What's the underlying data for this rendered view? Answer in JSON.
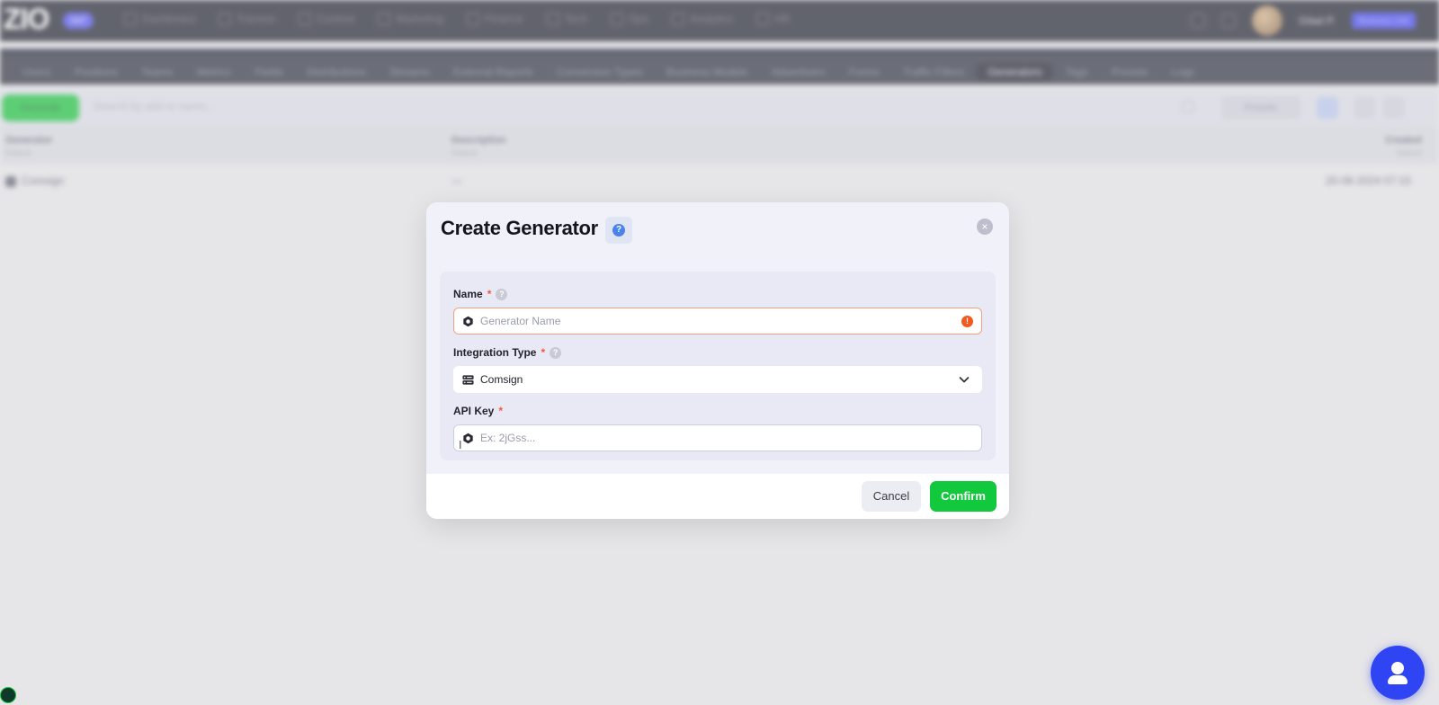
{
  "app": {
    "logo": {
      "text": "ZIO",
      "badge": "SNT"
    },
    "top_nav": [
      "Dashboard",
      "Traceon",
      "Content",
      "Marketing",
      "Finance",
      "Tech",
      "Ops",
      "Analytics",
      "HR"
    ],
    "user": {
      "name": "Gilad P.",
      "badge": "Business Unit"
    },
    "sub_nav": {
      "items": [
        "Users",
        "Positions",
        "Teams",
        "Metrics",
        "Fields",
        "Distributions",
        "Streams",
        "External Reports",
        "Conversion Types",
        "Business Models",
        "Advertisers",
        "Forms",
        "Traffic Filters",
        "Generators",
        "Tags",
        "Presets",
        "Logs"
      ],
      "active": "Generators"
    },
    "toolbar": {
      "new_button": "Generate",
      "search_placeholder": "Search by add or name...",
      "presets": "Presets"
    },
    "table": {
      "headers": [
        {
          "label": "Generator",
          "sub": "Default"
        },
        {
          "label": "Description",
          "sub": "Default"
        },
        {
          "label": "Created",
          "sub": "Default"
        }
      ],
      "rows": [
        {
          "name": "Comsign",
          "description": "—",
          "created": "20-06-2024 07:15"
        }
      ]
    }
  },
  "modal": {
    "title": "Create Generator",
    "help_glyph": "?",
    "close_glyph": "×",
    "fields": {
      "name": {
        "label": "Name",
        "required_mark": "*",
        "hint_glyph": "?",
        "placeholder": "Generator Name",
        "value": "",
        "error_glyph": "!"
      },
      "integration_type": {
        "label": "Integration Type",
        "required_mark": "*",
        "hint_glyph": "?",
        "value": "Comsign"
      },
      "api_key": {
        "label": "API Key",
        "required_mark": "*",
        "placeholder": "Ex: 2jGss...",
        "value": ""
      }
    },
    "buttons": {
      "cancel": "Cancel",
      "confirm": "Confirm"
    }
  },
  "colors": {
    "accent_green": "#12c83c",
    "error_orange": "#f2591e",
    "help_blue": "#4a82ec",
    "fab_blue": "#2f44f2"
  }
}
